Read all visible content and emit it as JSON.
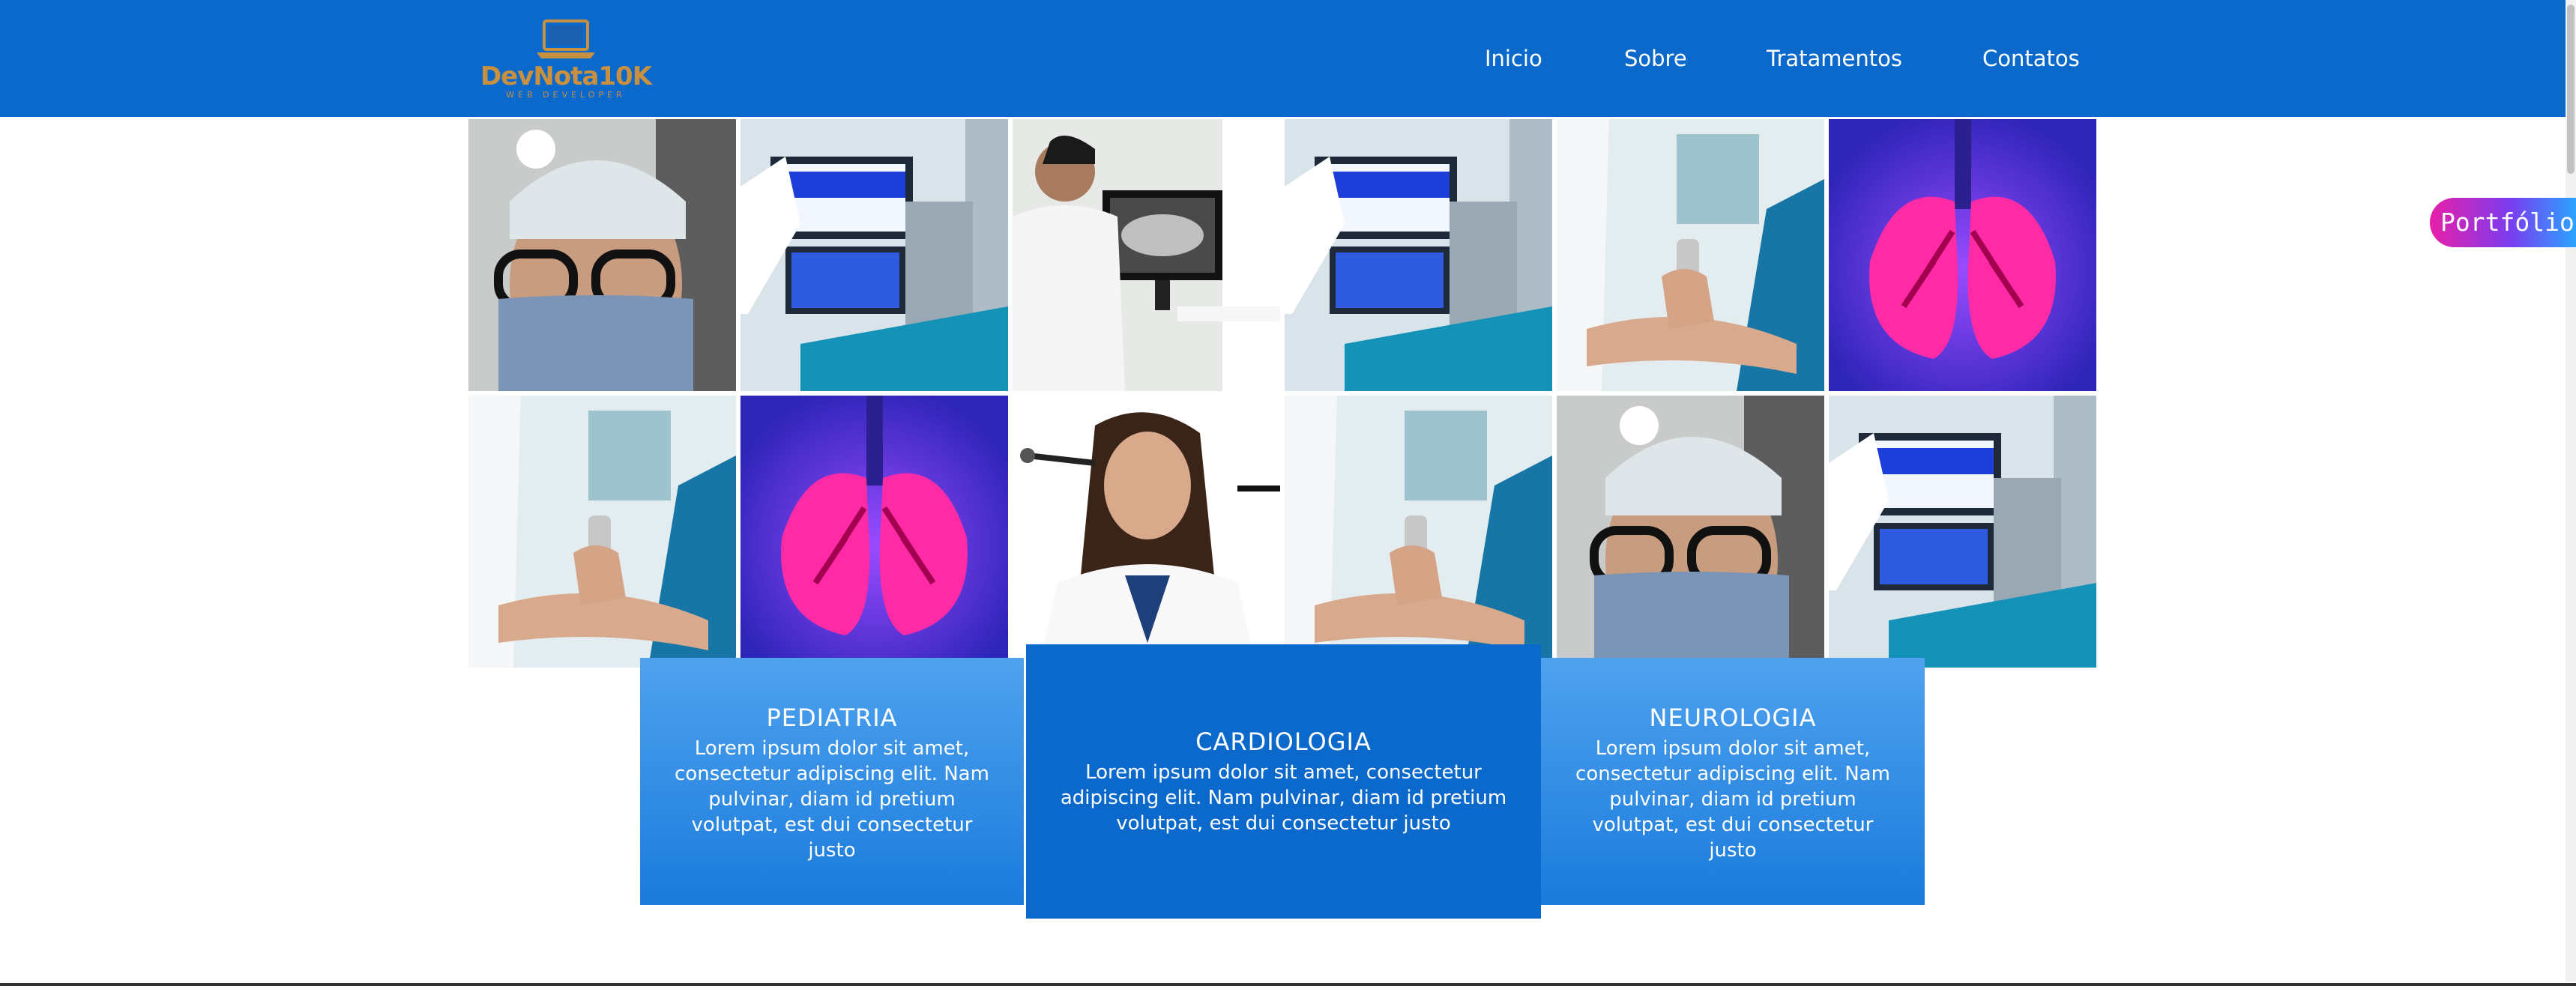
{
  "header": {
    "brand": "DevNota10K",
    "brand_tagline": "WEB DEVELOPER",
    "nav": [
      {
        "label": "Inicio"
      },
      {
        "label": "Sobre"
      },
      {
        "label": "Tratamentos"
      },
      {
        "label": "Contatos"
      }
    ]
  },
  "gallery": {
    "photos": [
      {
        "name": "doctor-surgeon-photo",
        "icon": "surgeon-with-headlamp"
      },
      {
        "name": "ecg-monitor-photo",
        "icon": "medical-monitor"
      },
      {
        "name": "dentist-xray-photo",
        "icon": "doctor-viewing-xray"
      },
      {
        "name": "ecg-monitor-photo",
        "icon": "medical-monitor"
      },
      {
        "name": "ultrasound-exam-photo",
        "icon": "ultrasound-probe"
      },
      {
        "name": "lungs-illustration",
        "icon": "lungs"
      },
      {
        "name": "ultrasound-exam-photo",
        "icon": "ultrasound-probe"
      },
      {
        "name": "lungs-illustration",
        "icon": "lungs"
      },
      {
        "name": "doctor-stethoscope-photo",
        "icon": "female-doctor"
      },
      {
        "name": "ultrasound-exam-photo",
        "icon": "ultrasound-probe"
      },
      {
        "name": "doctor-surgeon-photo",
        "icon": "surgeon-with-headlamp"
      },
      {
        "name": "ecg-monitor-photo",
        "icon": "medical-monitor"
      }
    ]
  },
  "specialties": [
    {
      "title": "PEDIATRIA",
      "text": "Lorem ipsum dolor sit amet, consectetur adipiscing elit. Nam pulvinar, diam id pretium volutpat, est dui consectetur justo"
    },
    {
      "title": "CARDIOLOGIA",
      "text": "Lorem ipsum dolor sit amet, consectetur adipiscing elit. Nam pulvinar, diam id pretium volutpat, est dui consectetur justo"
    },
    {
      "title": "NEUROLOGIA",
      "text": "Lorem ipsum dolor sit amet, consectetur adipiscing elit. Nam pulvinar, diam id pretium volutpat, est dui consectetur justo"
    }
  ],
  "portfolio_tab": {
    "label": "Portfólio"
  },
  "colors": {
    "header_bg": "#0a69cb",
    "card_side_gradient": [
      "#4fa2ee",
      "#1a7bdc"
    ],
    "card_main_bg": "#0a69cb",
    "logo_gold": "#c9913f",
    "portfolio_gradient": [
      "#e81ea8",
      "#7a3df0",
      "#2aa4ff"
    ]
  }
}
